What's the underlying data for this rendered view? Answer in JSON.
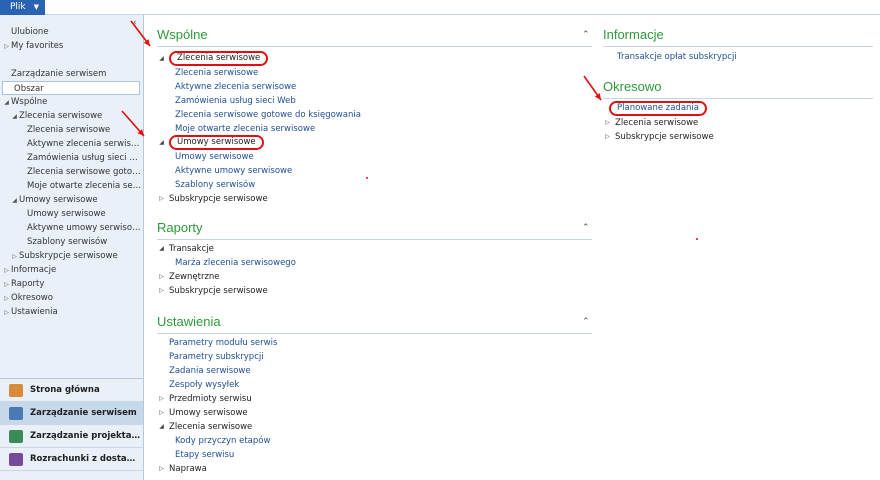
{
  "file_menu": {
    "label": "Plik"
  },
  "left_nav": {
    "collapse_glyph": "‹",
    "tree": [
      {
        "label": "Ulubione",
        "level": 0,
        "expander": "",
        "selected": false
      },
      {
        "label": "My favorites",
        "level": 0,
        "expander": "▷",
        "selected": false
      },
      {
        "label": "Zarządzanie serwisem",
        "level": 0,
        "expander": "",
        "selected": false,
        "gap_before": true
      },
      {
        "label": "Obszar",
        "level": 0,
        "expander": "",
        "selected": true
      },
      {
        "label": "Wspólne",
        "level": 0,
        "expander": "◢",
        "selected": false
      },
      {
        "label": "Zlecenia serwisowe",
        "level": 1,
        "expander": "◢",
        "selected": false
      },
      {
        "label": "Zlecenia serwisowe",
        "level": 2,
        "expander": "",
        "selected": false
      },
      {
        "label": "Aktywne zlecenia serwisowe",
        "level": 2,
        "expander": "",
        "selected": false
      },
      {
        "label": "Zamówienia usług sieci Web",
        "level": 2,
        "expander": "",
        "selected": false
      },
      {
        "label": "Zlecenia serwisowe gotowe...",
        "level": 2,
        "expander": "",
        "selected": false
      },
      {
        "label": "Moje otwarte zlecenia serwi...",
        "level": 2,
        "expander": "",
        "selected": false
      },
      {
        "label": "Umowy serwisowe",
        "level": 1,
        "expander": "◢",
        "selected": false
      },
      {
        "label": "Umowy serwisowe",
        "level": 2,
        "expander": "",
        "selected": false
      },
      {
        "label": "Aktywne umowy serwisowe",
        "level": 2,
        "expander": "",
        "selected": false
      },
      {
        "label": "Szablony serwisów",
        "level": 2,
        "expander": "",
        "selected": false
      },
      {
        "label": "Subskrypcje serwisowe",
        "level": 1,
        "expander": "▷",
        "selected": false
      },
      {
        "label": "Informacje",
        "level": 0,
        "expander": "▷",
        "selected": false
      },
      {
        "label": "Raporty",
        "level": 0,
        "expander": "▷",
        "selected": false
      },
      {
        "label": "Okresowo",
        "level": 0,
        "expander": "▷",
        "selected": false
      },
      {
        "label": "Ustawienia",
        "level": 0,
        "expander": "▷",
        "selected": false
      }
    ],
    "buttons": [
      {
        "label": "Strona główna",
        "icon": "home-icon",
        "color": "#d98a3a",
        "active": false
      },
      {
        "label": "Zarządzanie serwisem",
        "icon": "service-icon",
        "color": "#4a7ab5",
        "active": true
      },
      {
        "label": "Zarządzanie projektami i i...",
        "icon": "project-icon",
        "color": "#3a8a5a",
        "active": false
      },
      {
        "label": "Rozrachunki z dostawcami",
        "icon": "vendor-icon",
        "color": "#7a4a9a",
        "active": false
      }
    ]
  },
  "sections": {
    "wspolne": {
      "title": "Wspólne",
      "groups": [
        {
          "label": "Zlecenia serwisowe",
          "expander": "◢",
          "highlighted": true,
          "links": [
            "Zlecenia serwisowe",
            "Aktywne zlecenia serwisowe",
            "Zamówienia usług sieci Web",
            "Zlecenia serwisowe gotowe do księgowania",
            "Moje otwarte zlecenia serwisowe"
          ]
        },
        {
          "label": "Umowy serwisowe",
          "expander": "◢",
          "highlighted": true,
          "links": [
            "Umowy serwisowe",
            "Aktywne umowy serwisowe",
            "Szablony serwisów"
          ]
        },
        {
          "label": "Subskrypcje serwisowe",
          "expander": "▷",
          "highlighted": false,
          "links": []
        }
      ]
    },
    "raporty": {
      "title": "Raporty",
      "groups": [
        {
          "label": "Transakcje",
          "expander": "◢",
          "links": [
            "Marża zlecenia serwisowego"
          ]
        },
        {
          "label": "Zewnętrzne",
          "expander": "▷",
          "links": []
        },
        {
          "label": "Subskrypcje serwisowe",
          "expander": "▷",
          "links": []
        }
      ]
    },
    "ustawienia": {
      "title": "Ustawienia",
      "top_links": [
        "Parametry modułu serwis",
        "Parametry subskrypcji",
        "Zadania serwisowe",
        "Zespoły wysyłek"
      ],
      "groups": [
        {
          "label": "Przedmioty serwisu",
          "expander": "▷",
          "links": []
        },
        {
          "label": "Umowy serwisowe",
          "expander": "▷",
          "links": []
        },
        {
          "label": "Zlecenia serwisowe",
          "expander": "◢",
          "links": [
            "Kody przyczyn etapów",
            "Etapy serwisu"
          ]
        },
        {
          "label": "Naprawa",
          "expander": "▷",
          "links": []
        }
      ]
    },
    "informacje": {
      "title": "Informacje",
      "links": [
        "Transakcje opłat subskrypcji"
      ]
    },
    "okresowo": {
      "title": "Okresowo",
      "highlighted_link": "Planowane zadania",
      "groups": [
        {
          "label": "Zlecenia serwisowe",
          "expander": "▷"
        },
        {
          "label": "Subskrypcje serwisowe",
          "expander": "▷"
        }
      ]
    }
  },
  "colors": {
    "accent": "#2a63b3",
    "section_title": "#2e9a3a",
    "link": "#1f4e96",
    "annotation": "#e01010"
  }
}
